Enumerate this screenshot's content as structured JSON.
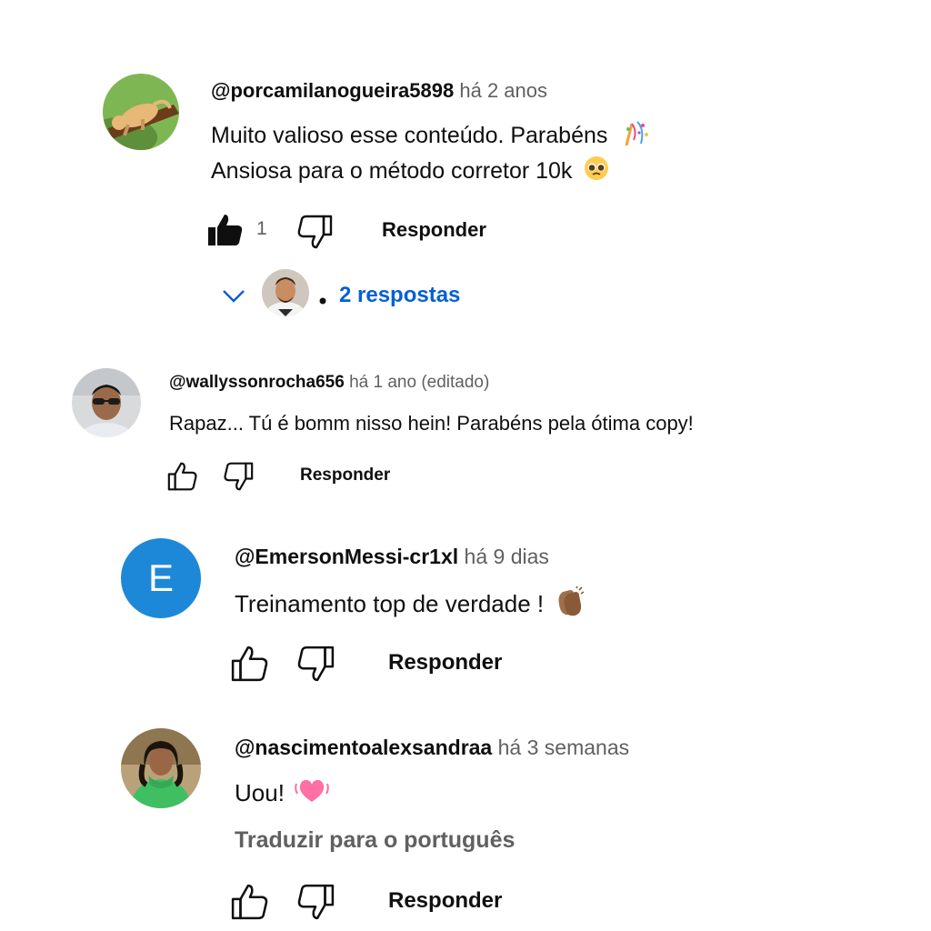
{
  "comments": [
    {
      "handle": "@porcamilanogueira5898",
      "time": "há 2 anos",
      "lines": [
        "Muito valioso esse conteúdo. Parabéns",
        "Ansiosa para o método corretor 10k"
      ],
      "emojis": [
        "confetti-icon",
        "pleading-face-icon"
      ],
      "likes": "1",
      "liked": true,
      "reply_label": "Responder",
      "replies_label": "2 respostas"
    },
    {
      "handle": "@wallyssonrocha656",
      "time": "há 1 ano (editado)",
      "lines": [
        "Rapaz... Tú é bomm nisso hein! Parabéns pela ótima copy!"
      ],
      "reply_label": "Responder"
    },
    {
      "handle": "@EmersonMessi-cr1xl",
      "time": "há 9 dias",
      "avatar_letter": "E",
      "avatar_color": "#1e88d8",
      "lines": [
        "Treinamento top de verdade !"
      ],
      "emojis": [
        "clapping-hands-icon"
      ],
      "reply_label": "Responder"
    },
    {
      "handle": "@nascimentoalexsandraa",
      "time": "há 3 semanas",
      "lines": [
        "Uou!"
      ],
      "emojis": [
        "beating-heart-icon"
      ],
      "translate_label": "Traduzir para o português",
      "reply_label": "Responder"
    }
  ]
}
